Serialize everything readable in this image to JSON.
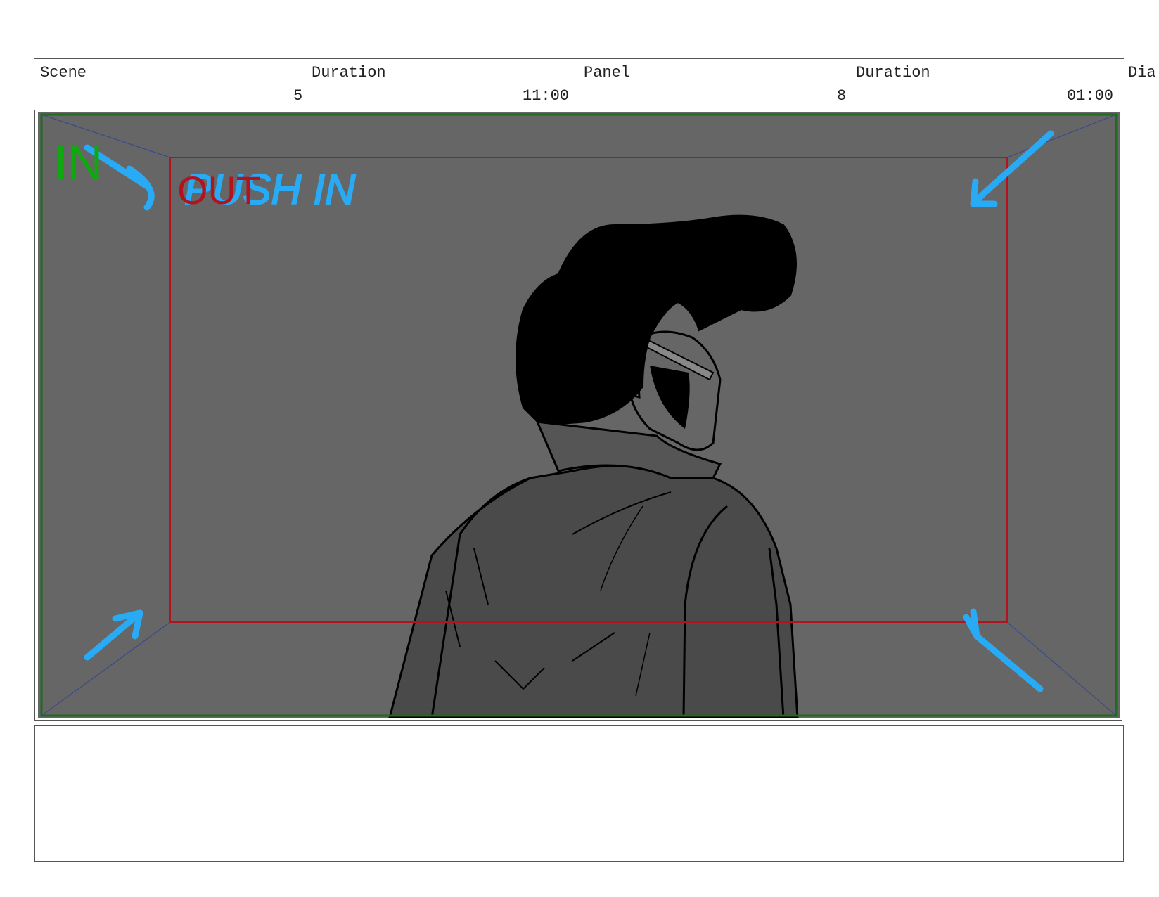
{
  "header": {
    "scene_label": "Scene",
    "scene_duration_label": "Duration",
    "panel_label": "Panel",
    "panel_duration_label": "Duration",
    "dialogue_label_partial": "Dia",
    "scene_value": "5",
    "scene_duration_value": "11:00",
    "panel_value": "8",
    "panel_duration_value": "01:00"
  },
  "panel": {
    "annotation_in": "IN",
    "annotation_out": "OUT",
    "annotation_move": "PUSH IN"
  },
  "notes": {
    "text": ""
  },
  "colors": {
    "background": "#666666",
    "in_frame": "#1f6b1f",
    "out_frame": "#b3121f",
    "annotation_blue": "#29aaf5",
    "in_text": "#0fa80f",
    "out_text": "#b3121f"
  }
}
